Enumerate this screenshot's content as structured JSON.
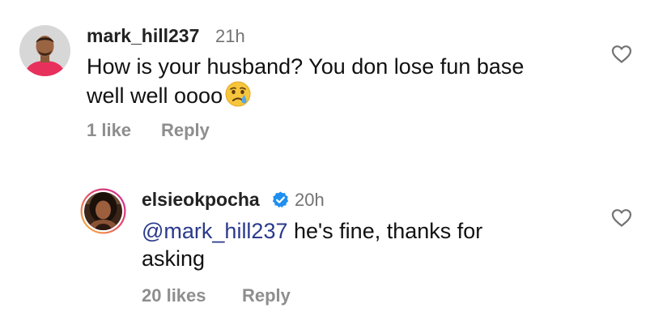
{
  "comments": [
    {
      "username": "mark_hill237",
      "time": "21h",
      "text": "How is your husband? You don lose fun base",
      "text_line2": "well well oooo",
      "emoji": "crying-face",
      "likes": "1 like",
      "reply_label": "Reply"
    },
    {
      "username": "elsieokpocha",
      "verified": true,
      "time": "20h",
      "mention": "@mark_hill237",
      "text": " he's fine, thanks for",
      "text_line2": "asking",
      "likes": "20 likes",
      "reply_label": "Reply"
    }
  ],
  "colors": {
    "mention": "#2b3a8c",
    "verified": "#1f8ff0",
    "meta": "#8e8e8e",
    "story_ring_start": "#f7c23a",
    "story_ring_end": "#d52b8a"
  }
}
